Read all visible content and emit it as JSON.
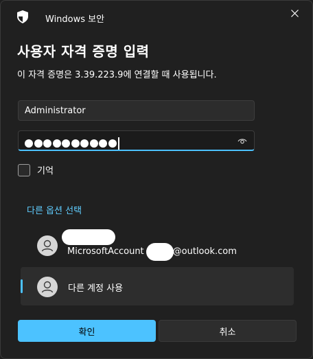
{
  "window": {
    "title": "Windows 보안"
  },
  "dialog": {
    "heading": "사용자 자격 증명 입력",
    "subtitle": "이 자격 증명은 3.39.223.9에 연결할 때 사용됩니다."
  },
  "username": {
    "value": "Administrator"
  },
  "password": {
    "masked_length": 10
  },
  "remember": {
    "label": "기억",
    "checked": false
  },
  "more_options": {
    "label": "다른 옵션 선택"
  },
  "accounts": {
    "microsoft": {
      "email_prefix": "MicrosoftAccount",
      "email_suffix": "@outlook.com"
    },
    "other": {
      "label": "다른 계정 사용"
    }
  },
  "buttons": {
    "ok_label": "확인",
    "cancel_label": "취소"
  },
  "colors": {
    "accent": "#4cc2ff",
    "link": "#60cdff",
    "background": "#202020"
  }
}
